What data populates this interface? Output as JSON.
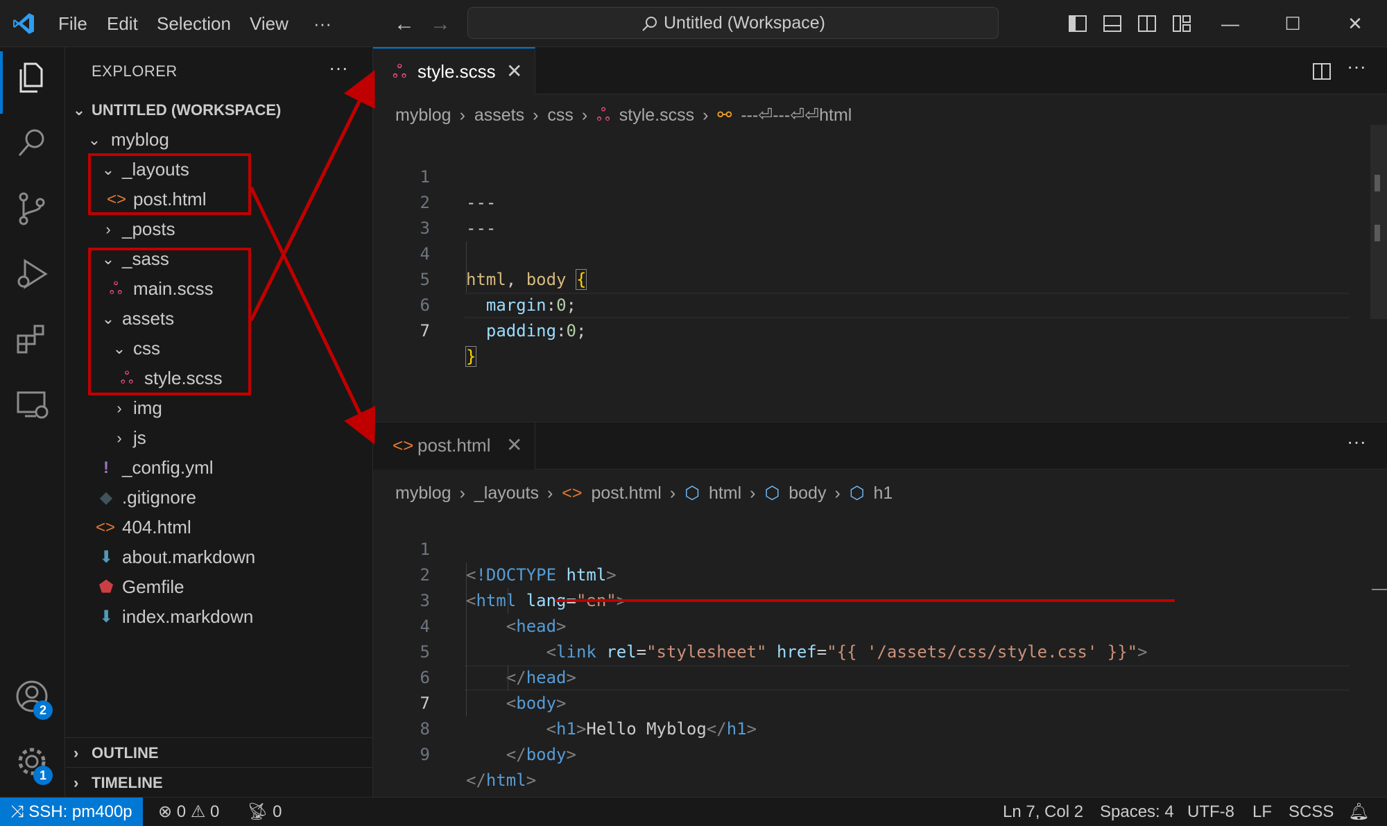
{
  "titlebar": {
    "menu": [
      "File",
      "Edit",
      "Selection",
      "View",
      "···"
    ],
    "command_center": "Untitled (Workspace)",
    "window_controls": [
      "minimize",
      "maximize",
      "close"
    ]
  },
  "activity_bar": {
    "items": [
      "explorer-icon",
      "search-icon",
      "source-control-icon",
      "run-debug-icon",
      "extensions-icon",
      "remote-explorer-icon"
    ],
    "accounts_badge": "2",
    "settings_badge": "1"
  },
  "sidebar": {
    "title": "EXPLORER",
    "more": "···",
    "workspace": "UNTITLED (WORKSPACE)",
    "tree": [
      {
        "label": "myblog",
        "kind": "folder-open"
      },
      {
        "label": "_layouts",
        "kind": "folder-open"
      },
      {
        "label": "post.html",
        "kind": "html"
      },
      {
        "label": "_posts",
        "kind": "folder-closed"
      },
      {
        "label": "_sass",
        "kind": "folder-open"
      },
      {
        "label": "main.scss",
        "kind": "scss"
      },
      {
        "label": "assets",
        "kind": "folder-open"
      },
      {
        "label": "css",
        "kind": "folder-open"
      },
      {
        "label": "style.scss",
        "kind": "scss"
      },
      {
        "label": "img",
        "kind": "folder-closed"
      },
      {
        "label": "js",
        "kind": "folder-closed"
      },
      {
        "label": "_config.yml",
        "kind": "yaml"
      },
      {
        "label": ".gitignore",
        "kind": "git"
      },
      {
        "label": "404.html",
        "kind": "html"
      },
      {
        "label": "about.markdown",
        "kind": "markdown"
      },
      {
        "label": "Gemfile",
        "kind": "ruby"
      },
      {
        "label": "index.markdown",
        "kind": "markdown"
      }
    ],
    "outline": "OUTLINE",
    "timeline": "TIMELINE"
  },
  "editor_top": {
    "tab": "style.scss",
    "breadcrumb": [
      "myblog",
      "assets",
      "css",
      "style.scss",
      "---⏎---⏎⏎html"
    ],
    "lines": [
      "---",
      "---",
      "",
      "html, body {",
      "  margin:0;",
      "  padding:0;",
      "}"
    ]
  },
  "editor_bottom": {
    "tab": "post.html",
    "breadcrumb": [
      "myblog",
      "_layouts",
      "post.html",
      "html",
      "body",
      "h1"
    ],
    "lines": [
      "<!DOCTYPE html>",
      "<html lang=\"en\">",
      "<head>",
      "<link rel=\"stylesheet\" href=\"{{ '/assets/css/style.css' }}\">",
      "</head>",
      "<body>",
      "<h1>Hello Myblog</h1>",
      "</body>",
      "</html>"
    ]
  },
  "statusbar": {
    "remote": "SSH: pm400p",
    "errors": "0",
    "warnings": "0",
    "ports": "0",
    "position": "Ln 7, Col 2",
    "spaces": "Spaces: 4",
    "encoding": "UTF-8",
    "eol": "LF",
    "language": "SCSS"
  },
  "colors": {
    "accent": "#0078d4",
    "annotation": "#c00000",
    "scss_icon": "#f55385",
    "html_icon": "#e37933"
  }
}
